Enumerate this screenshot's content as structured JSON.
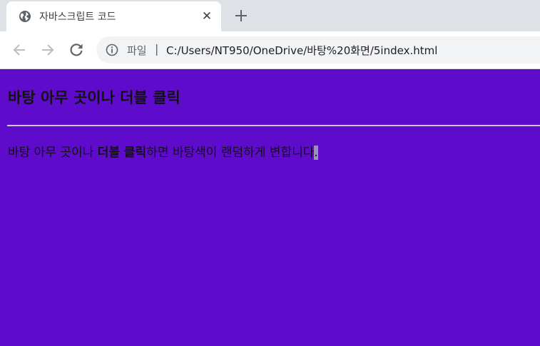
{
  "tab": {
    "title": "자바스크립트 코드",
    "favicon": "globe-icon",
    "close_symbol": "✕"
  },
  "toolbar": {
    "back_icon": "arrow-left-icon",
    "forward_icon": "arrow-right-icon",
    "reload_icon": "reload-icon",
    "site_info_icon": "info-icon",
    "scheme_label": "파일",
    "separator": "|",
    "url": "C:/Users/NT950/OneDrive/바탕%20화면/5index.html"
  },
  "page": {
    "background": "#5f0bcc",
    "heading": "바탕 아무 곳이나 더블 클릭",
    "text_before": "바탕 아무 곳이나 ",
    "text_bold": "더블 클릭",
    "text_after": "하면 바탕색이 랜덤하게 변합니다",
    "text_end": "."
  }
}
